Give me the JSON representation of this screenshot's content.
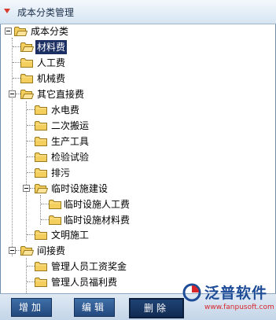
{
  "window": {
    "title": "成本分类管理"
  },
  "tree": {
    "root": "成本分类",
    "level1": [
      "材料费",
      "人工费",
      "机械费",
      "其它直接费",
      "间接费"
    ],
    "other_direct": [
      "水电费",
      "二次搬运",
      "生产工具",
      "检验试验",
      "排污",
      "临时设施建设",
      "文明施工"
    ],
    "temp_facility": [
      "临时设施人工费",
      "临时设施材料费"
    ],
    "indirect": [
      "管理人员工资奖金",
      "管理人员福利费"
    ]
  },
  "buttons": {
    "add": "增加",
    "edit": "编辑",
    "delete": "删除"
  },
  "logo": {
    "name": "泛普软件",
    "url": "www.fanpusoft.com"
  },
  "colors": {
    "selection": "#1c2f63",
    "button": "#2f5b92",
    "brand": "#1e4c97",
    "url": "#d9262b"
  }
}
